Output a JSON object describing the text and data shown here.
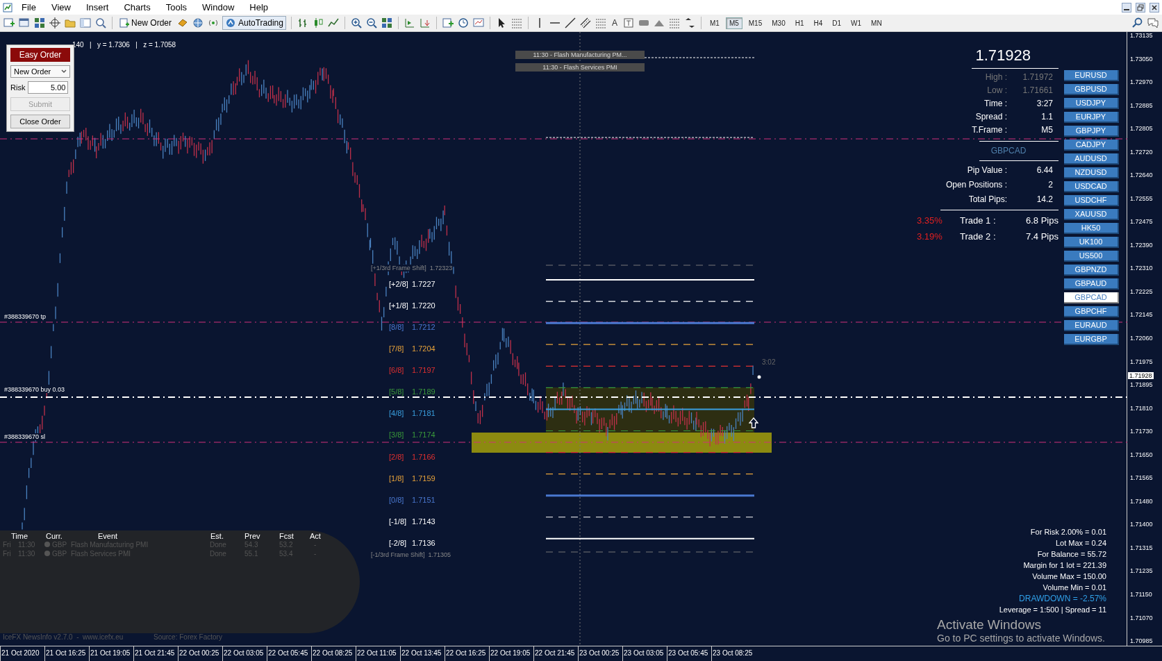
{
  "menu": {
    "items": [
      "File",
      "View",
      "Insert",
      "Charts",
      "Tools",
      "Window",
      "Help"
    ]
  },
  "toolbar": {
    "new_order": "New Order",
    "autotrading": "AutoTrading",
    "text_tool": "A",
    "timeframes": [
      {
        "label": "M1",
        "selected": false
      },
      {
        "label": "M5",
        "selected": true
      },
      {
        "label": "M15",
        "selected": false
      },
      {
        "label": "M30",
        "selected": false
      },
      {
        "label": "H1",
        "selected": false
      },
      {
        "label": "H4",
        "selected": false
      },
      {
        "label": "D1",
        "selected": false
      },
      {
        "label": "W1",
        "selected": false
      },
      {
        "label": "MN",
        "selected": false
      }
    ]
  },
  "chart": {
    "crosshair_readout": "140   |   y = 1.7306   |   z = 1.7058",
    "easy_order": {
      "title": "Easy Order",
      "order_type": "New Order",
      "risk_label": "Risk",
      "risk_value": "5.00",
      "buttons": [
        {
          "label": "Submit",
          "disabled": true
        },
        {
          "label": "Close Order",
          "disabled": false
        }
      ]
    },
    "news_markers": [
      "11:30 - Flash Manufacturing PM...",
      "11:30 - Flash Services PMI"
    ],
    "order_labels": [
      {
        "text": "#388339670 tp",
        "kind": "tp"
      },
      {
        "text": "#388339670 buy 0.03",
        "kind": "entry"
      },
      {
        "text": "#388339670 sl",
        "kind": "sl"
      }
    ],
    "frame_shift_labels": [
      "[+1/3rd Frame Shift]  1.72323",
      "[-1/3rd Frame Shift]  1.71305"
    ],
    "levels": [
      {
        "tag": "[+2/8]",
        "value": "1.7227",
        "color": "#ffffff",
        "kind": "solid"
      },
      {
        "tag": "[+1/8]",
        "value": "1.7220",
        "color": "#ffffff",
        "kind": "dashed"
      },
      {
        "tag": "[8/8]",
        "value": "1.7212",
        "color": "#4a78d0",
        "kind": "solid"
      },
      {
        "tag": "[7/8]",
        "value": "1.7204",
        "color": "#e8a33a",
        "kind": "dashed"
      },
      {
        "tag": "[6/8]",
        "value": "1.7197",
        "color": "#e03030",
        "kind": "dashed"
      },
      {
        "tag": "[5/8]",
        "value": "1.7189",
        "color": "#3a9a3a",
        "kind": "dashed"
      },
      {
        "tag": "[4/8]",
        "value": "1.7181",
        "color": "#3aa0e0",
        "kind": "solid"
      },
      {
        "tag": "[3/8]",
        "value": "1.7174",
        "color": "#3a9a3a",
        "kind": "dashed"
      },
      {
        "tag": "[2/8]",
        "value": "1.7166",
        "color": "#e03030",
        "kind": "dashed"
      },
      {
        "tag": "[1/8]",
        "value": "1.7159",
        "color": "#e8a33a",
        "kind": "dashed"
      },
      {
        "tag": "[0/8]",
        "value": "1.7151",
        "color": "#4a78d0",
        "kind": "solid"
      },
      {
        "tag": "[-1/8]",
        "value": "1.7143",
        "color": "#ffffff",
        "kind": "dashed"
      },
      {
        "tag": "[-2/8]",
        "value": "1.7136",
        "color": "#ffffff",
        "kind": "solid"
      }
    ],
    "elapsed": "3:02",
    "info": {
      "price": "1.71928",
      "stats": [
        {
          "label": "High :",
          "value": "1.71972",
          "dimmed": true
        },
        {
          "label": "Low :",
          "value": "1.71661",
          "dimmed": true
        },
        {
          "label": "Time :",
          "value": "3:27",
          "dimmed": false
        },
        {
          "label": "Spread :",
          "value": "1.1",
          "dimmed": false
        },
        {
          "label": "T.Frame :",
          "value": "M5",
          "dimmed": false
        }
      ],
      "symbol": "GBPCAD",
      "account": [
        {
          "label": "Pip Value :",
          "value": "6.44"
        },
        {
          "label": "Open Positions :",
          "value": "2"
        },
        {
          "label": "Total Pips:",
          "value": "14.2"
        }
      ],
      "trades": [
        {
          "percent": "3.35%",
          "label": "Trade 1 :",
          "value": "6.8 Pips"
        },
        {
          "percent": "3.19%",
          "label": "Trade 2 :",
          "value": "7.4 Pips"
        }
      ]
    },
    "symbols": [
      {
        "label": "EURUSD",
        "selected": false
      },
      {
        "label": "GBPUSD",
        "selected": false
      },
      {
        "label": "USDJPY",
        "selected": false
      },
      {
        "label": "EURJPY",
        "selected": false
      },
      {
        "label": "GBPJPY",
        "selected": false
      },
      {
        "label": "CADJPY",
        "selected": false
      },
      {
        "label": "AUDUSD",
        "selected": false
      },
      {
        "label": "NZDUSD",
        "selected": false
      },
      {
        "label": "USDCAD",
        "selected": false
      },
      {
        "label": "USDCHF",
        "selected": false
      },
      {
        "label": "XAUUSD",
        "selected": false
      },
      {
        "label": "HK50",
        "selected": false
      },
      {
        "label": "UK100",
        "selected": false
      },
      {
        "label": "US500",
        "selected": false
      },
      {
        "label": "GBPNZD",
        "selected": false
      },
      {
        "label": "GBPAUD",
        "selected": false
      },
      {
        "label": "GBPCAD",
        "selected": true
      },
      {
        "label": "GBPCHF",
        "selected": false
      },
      {
        "label": "EURAUD",
        "selected": false
      },
      {
        "label": "EURGBP",
        "selected": false
      }
    ],
    "risk_stats": [
      {
        "text": "For Risk 2.00% = 0.01",
        "kind": "normal"
      },
      {
        "text": "Lot Max = 0.24",
        "kind": "normal"
      },
      {
        "text": "For Balance = 55.72",
        "kind": "normal"
      },
      {
        "text": "Margin for 1 lot = 221.39",
        "kind": "normal"
      },
      {
        "text": "Volume Max = 150.00",
        "kind": "normal"
      },
      {
        "text": "Volume Min = 0.01",
        "kind": "normal"
      },
      {
        "text": "DRAWDOWN = -2.57%",
        "kind": "highlight"
      },
      {
        "text": "Leverage = 1:500 | Spread = 11",
        "kind": "normal"
      }
    ],
    "news_panel": {
      "columns": [
        "Time",
        "Curr.",
        "Event",
        "Est.",
        "Prev",
        "Fcst",
        "Act"
      ],
      "rows": [
        {
          "day": "Fri",
          "time": "11:30",
          "currency": "GBP",
          "event": "Flash Manufacturing PMI",
          "estimate": "Done",
          "prev": "54.3",
          "forecast": "53.2",
          "actual": "-"
        },
        {
          "day": "Fri",
          "time": "11:30",
          "currency": "GBP",
          "event": "Flash Services PMI",
          "estimate": "Done",
          "prev": "55.1",
          "forecast": "53.4",
          "actual": "-"
        }
      ],
      "footer": "IceFX NewsInfo v2.7.0  -  www.icefx.eu",
      "source": "Source: Forex Factory"
    },
    "price_axis": [
      "1.73135",
      "1.73050",
      "1.72970",
      "1.72885",
      "1.72805",
      "1.72720",
      "1.72640",
      "1.72555",
      "1.72475",
      "1.72390",
      "1.72310",
      "1.72225",
      "1.72145",
      "1.72060",
      "1.71975",
      "1.71895",
      "1.71810",
      "1.71730",
      "1.71650",
      "1.71565",
      "1.71480",
      "1.71400",
      "1.71315",
      "1.71235",
      "1.71150",
      "1.71070",
      "1.70985"
    ],
    "current_price": "1.71928",
    "time_axis": [
      "21 Oct 2020",
      "21 Oct 16:25",
      "21 Oct 19:05",
      "21 Oct 21:45",
      "22 Oct 00:25",
      "22 Oct 03:05",
      "22 Oct 05:45",
      "22 Oct 08:25",
      "22 Oct 11:05",
      "22 Oct 13:45",
      "22 Oct 16:25",
      "22 Oct 19:05",
      "22 Oct 21:45",
      "23 Oct 00:25",
      "23 Oct 03:05",
      "23 Oct 05:45",
      "23 Oct 08:25"
    ]
  },
  "os_notice": {
    "title": "Activate Windows",
    "text": "Go to PC settings to activate Windows."
  }
}
